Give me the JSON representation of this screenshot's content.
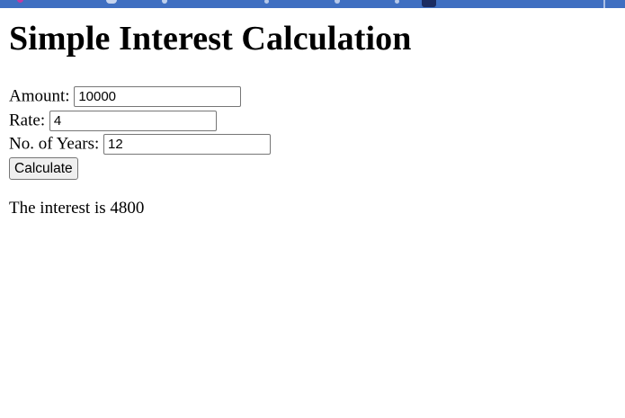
{
  "page": {
    "title": "Simple Interest Calculation"
  },
  "form": {
    "amount": {
      "label": "Amount:",
      "value": "10000"
    },
    "rate": {
      "label": "Rate:",
      "value": "4"
    },
    "years": {
      "label": "No. of Years:",
      "value": "12"
    },
    "calculate_label": "Calculate"
  },
  "result": {
    "text": "The interest is 4800"
  },
  "colors": {
    "browser_strip": "#3f6fc1",
    "background": "#ffffff",
    "button_bg": "#efefef"
  }
}
